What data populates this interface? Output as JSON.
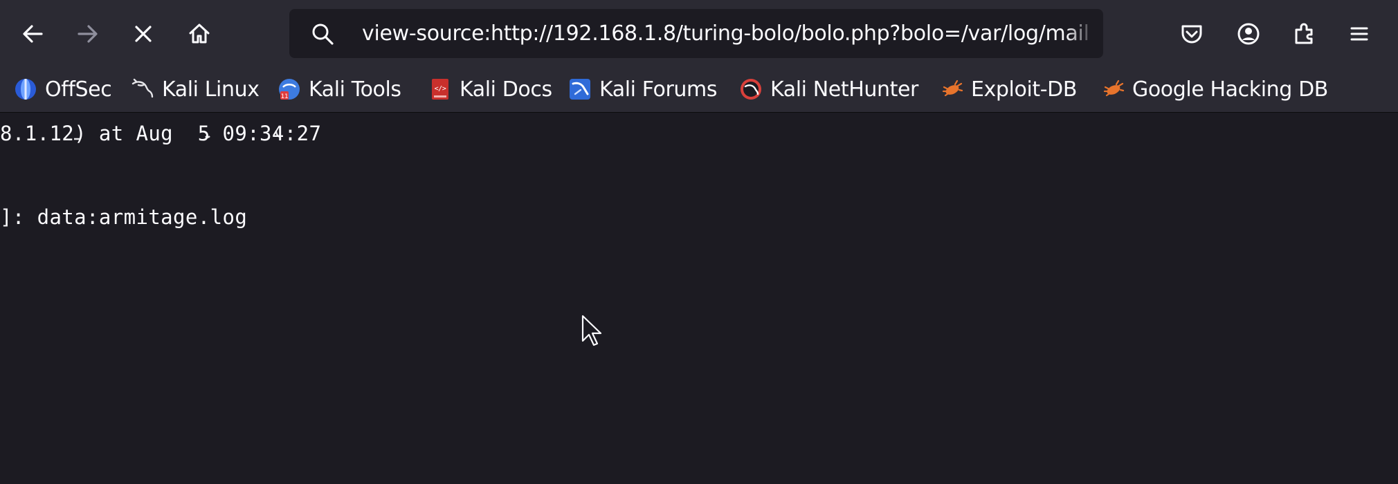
{
  "toolbar": {
    "back_icon": "arrow-left-icon",
    "forward_icon": "arrow-right-icon",
    "stop_icon": "close-icon",
    "home_icon": "home-icon",
    "pocket_icon": "pocket-icon",
    "account_icon": "account-icon",
    "extensions_icon": "extensions-icon",
    "menu_icon": "hamburger-menu-icon"
  },
  "urlbar": {
    "search_icon": "search-icon",
    "value": "view-source:http://192.168.1.8/turing-bolo/bolo.php?bolo=/var/log/mail"
  },
  "bookmarks": [
    {
      "label": "OffSec",
      "icon": "offsec-icon"
    },
    {
      "label": "Kali Linux",
      "icon": "kali-dragon-icon"
    },
    {
      "label": "Kali Tools",
      "icon": "kali-tools-icon"
    },
    {
      "label": "Kali Docs",
      "icon": "kali-docs-icon"
    },
    {
      "label": "Kali Forums",
      "icon": "kali-forums-icon"
    },
    {
      "label": "Kali NetHunter",
      "icon": "kali-nethunter-icon"
    },
    {
      "label": "Exploit-DB",
      "icon": "exploit-db-icon"
    },
    {
      "label": "Google Hacking DB",
      "icon": "ghdb-icon"
    }
  ],
  "source": {
    "lines": [
      "8.1.12) at Aug  5 09:34:27",
      "]: data:armitage.log"
    ]
  },
  "colors": {
    "toolbar_bg": "#2b2a33",
    "content_bg": "#1c1b22",
    "text": "#fbfbfe"
  }
}
